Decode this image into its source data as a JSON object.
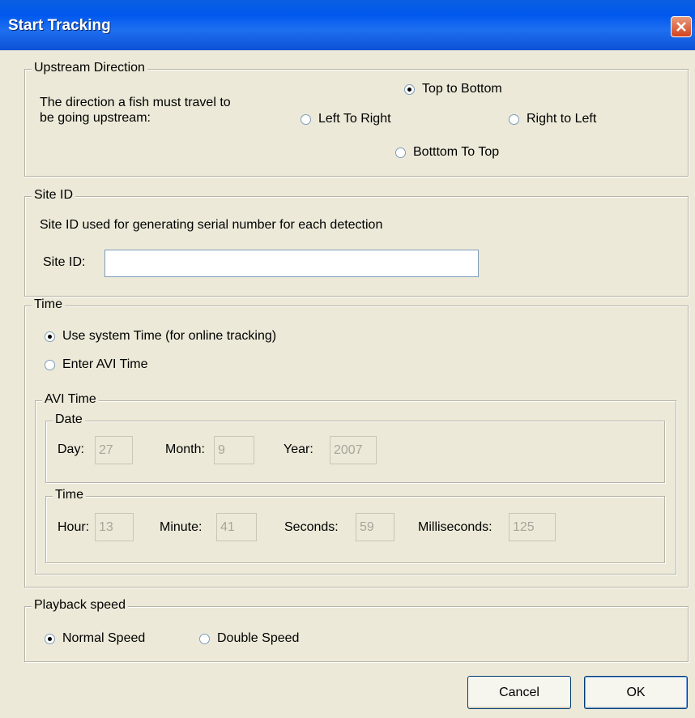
{
  "window": {
    "title": "Start Tracking"
  },
  "upstream": {
    "legend": "Upstream Direction",
    "description_line1": "The direction a fish must travel to",
    "description_line2": "be going upstream:",
    "options": {
      "top_to_bottom": "Top to Bottom",
      "left_to_right": "Left To Right",
      "right_to_left": "Right to Left",
      "bottom_to_top": "Botttom To Top"
    },
    "selected": "Top to Bottom"
  },
  "site": {
    "legend": "Site ID",
    "description": "Site ID used for generating serial number for each detection",
    "label": "Site ID:",
    "value": ""
  },
  "time": {
    "legend": "Time",
    "option_system": "Use system Time (for online tracking)",
    "option_avi": "Enter AVI Time",
    "selected": "Use system Time (for online tracking)",
    "avi_legend": "AVI Time",
    "date": {
      "legend": "Date",
      "day_label": "Day:",
      "day_value": "27",
      "month_label": "Month:",
      "month_value": "9",
      "year_label": "Year:",
      "year_value": "2007"
    },
    "clock": {
      "legend": "Time",
      "hour_label": "Hour:",
      "hour_value": "13",
      "minute_label": "Minute:",
      "minute_value": "41",
      "seconds_label": "Seconds:",
      "seconds_value": "59",
      "ms_label": "Milliseconds:",
      "ms_value": "125"
    }
  },
  "playback": {
    "legend": "Playback speed",
    "option_normal": "Normal Speed",
    "option_double": "Double Speed",
    "selected": "Normal Speed"
  },
  "buttons": {
    "cancel": "Cancel",
    "ok": "OK"
  }
}
